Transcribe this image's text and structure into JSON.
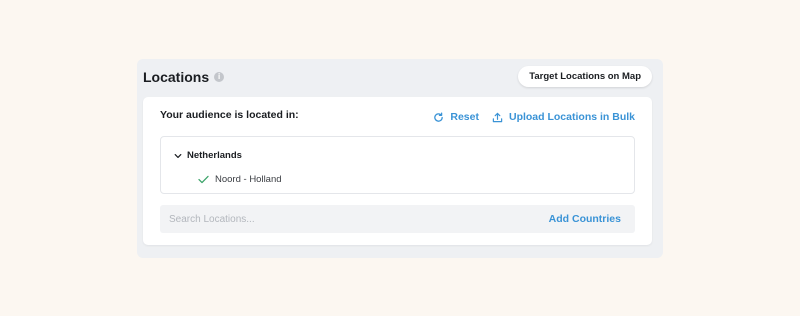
{
  "header": {
    "title": "Locations",
    "info_glyph": "i",
    "map_button_label": "Target Locations on Map"
  },
  "card": {
    "audience_label": "Your audience is located in:",
    "reset_label": "Reset",
    "upload_label": "Upload Locations in Bulk"
  },
  "tree": {
    "country": "Netherlands",
    "region": "Noord - Holland"
  },
  "search": {
    "placeholder": "Search Locations...",
    "add_label": "Add Countries"
  },
  "colors": {
    "accent": "#3a93d6",
    "check": "#3da46a",
    "background": "#fcf7f1",
    "panel": "#eef0f3"
  },
  "icons": {
    "info": "info-icon",
    "reset": "refresh-icon",
    "upload": "upload-icon",
    "expand": "chevron-down-icon",
    "selected": "check-icon"
  }
}
